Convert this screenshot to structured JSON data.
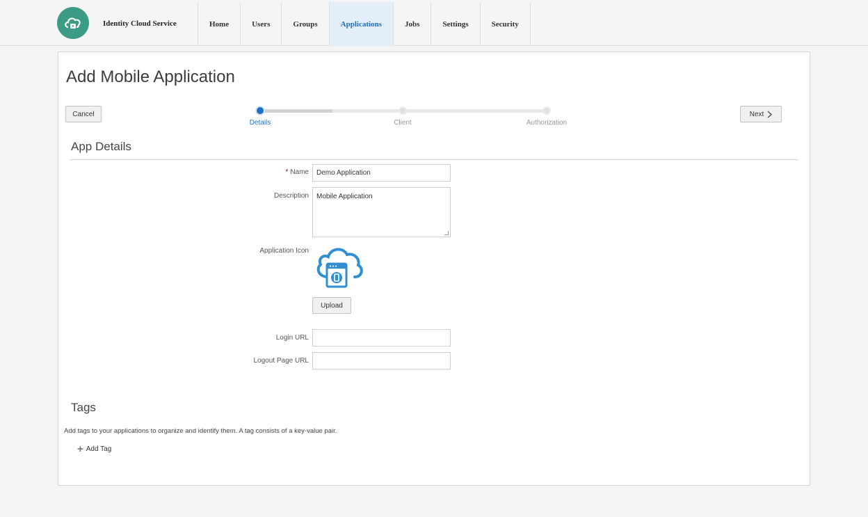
{
  "header": {
    "brand": "Identity Cloud Service",
    "nav": [
      "Home",
      "Users",
      "Groups",
      "Applications",
      "Jobs",
      "Settings",
      "Security"
    ],
    "active_nav": "Applications",
    "accent_color": "#3b9b84"
  },
  "page": {
    "title": "Add Mobile Application",
    "cancel_label": "Cancel",
    "next_label": "Next",
    "steps": [
      "Details",
      "Client",
      "Authorization"
    ],
    "current_step": "Details"
  },
  "app_details": {
    "section_title": "App Details",
    "name_label": "Name",
    "name_value": "Demo Application",
    "description_label": "Description",
    "description_value": "Mobile Application",
    "icon_label": "Application Icon",
    "upload_label": "Upload",
    "login_url_label": "Login URL",
    "login_url_value": "",
    "logout_url_label": "Logout Page URL",
    "logout_url_value": ""
  },
  "tags": {
    "section_title": "Tags",
    "description": "Add tags to your applications to organize and identify them. A tag consists of a key-value pair.",
    "add_label": "Add Tag"
  },
  "icons": [
    "cloud-lock-icon",
    "chevron-right-icon",
    "cloud-mobile-app-icon",
    "plus-icon"
  ]
}
